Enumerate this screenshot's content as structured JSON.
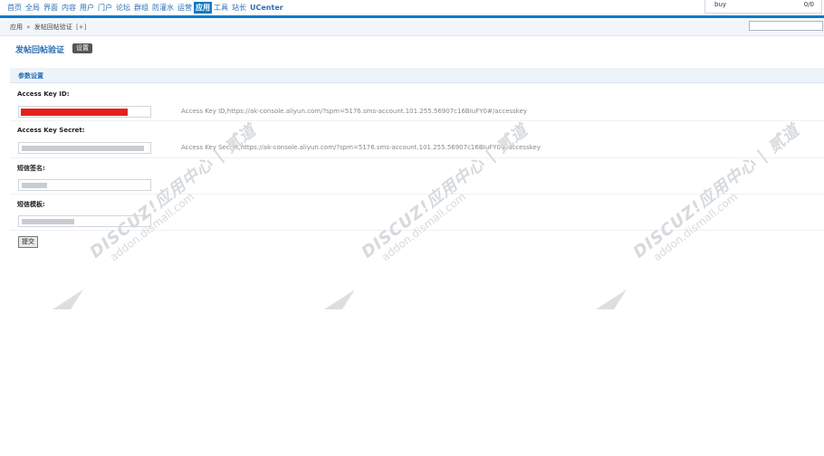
{
  "nav": {
    "items": [
      "首页",
      "全局",
      "界面",
      "内容",
      "用户",
      "门户",
      "论坛",
      "群组",
      "防灌水",
      "运营",
      "应用",
      "工具",
      "站长",
      "UCenter"
    ],
    "active_index": 10
  },
  "buybox": {
    "label": "buy",
    "value": "0/0"
  },
  "breadcrumb": {
    "root": "应用",
    "separator": "»",
    "current": "发帖回帖验证",
    "add": "[+]"
  },
  "page": {
    "title": "发帖回帖验证",
    "settings_button": "设置"
  },
  "section": {
    "title": "参数设置"
  },
  "fields": [
    {
      "label": "Access Key ID:",
      "tip": "Access Key ID,https://ak-console.aliyun.com/?spm=5176.sms-account.101.255.56907c16BIuFY0#/accesskey"
    },
    {
      "label": "Access Key Secret:",
      "tip": "Access Key Secret,https://ak-console.aliyun.com/?spm=5176.sms-account.101.255.56907c16BIuFY0#/accesskey"
    },
    {
      "label": "短信签名:",
      "tip": ""
    },
    {
      "label": "短信模板:",
      "tip": ""
    }
  ],
  "submit_label": "提交",
  "watermark": {
    "brand": "DISCUZ!应用中心 | 贰道",
    "domain": "addon.dismall.com"
  },
  "colors": {
    "nav_accent": "#0f7ac6",
    "link": "#2b6fb6",
    "redaction": "#e8201c"
  }
}
